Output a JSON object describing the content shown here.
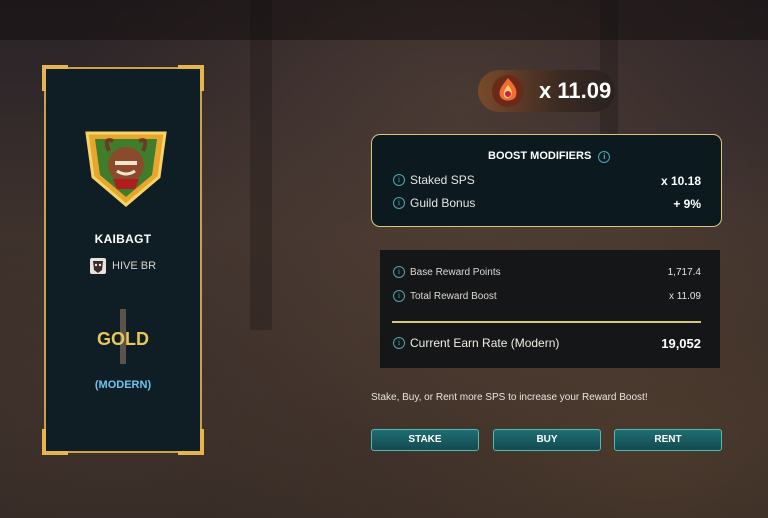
{
  "player": {
    "name": "KAIBAGT",
    "guild": "HIVE BR",
    "league": "GOLD",
    "format": "(MODERN)"
  },
  "boost": {
    "multiplier": "x 11.09"
  },
  "modifiers": {
    "title": "BOOST MODIFIERS",
    "items": [
      {
        "label": "Staked SPS",
        "value": "x 10.18"
      },
      {
        "label": "Guild Bonus",
        "value": "+ 9%"
      }
    ]
  },
  "points": {
    "base_label": "Base Reward Points",
    "base_value": "1,717.4",
    "total_label": "Total Reward Boost",
    "total_value": "x 11.09",
    "earn_label": "Current Earn Rate (Modern)",
    "earn_value": "19,052"
  },
  "cta": "Stake, Buy, or Rent more SPS to increase your Reward Boost!",
  "buttons": {
    "stake": "STAKE",
    "buy": "BUY",
    "rent": "RENT"
  },
  "colors": {
    "accent_gold": "#d8c77a",
    "league_gold": "#e8c65a",
    "format_blue": "#6fc3f0",
    "button_teal": "#1f6e73"
  }
}
